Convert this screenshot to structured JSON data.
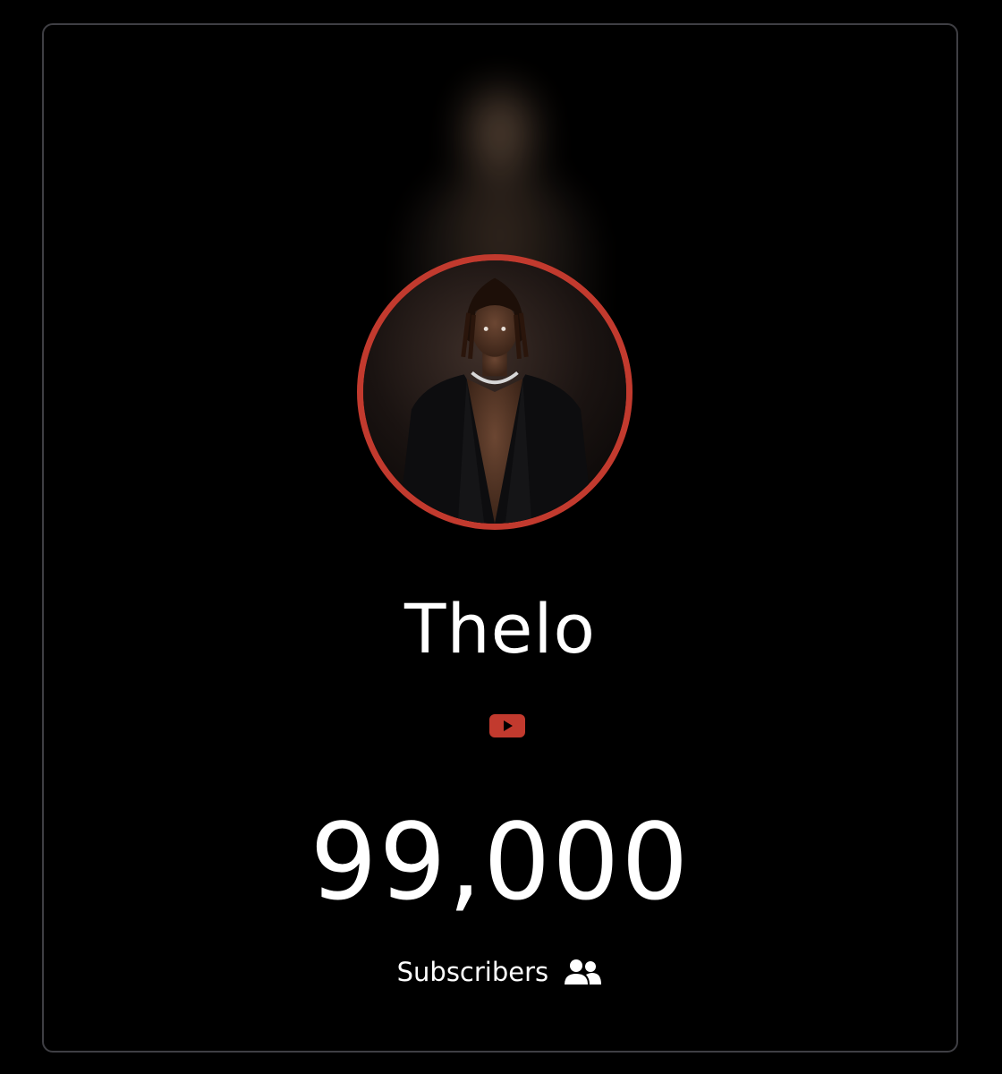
{
  "profile": {
    "name": "Thelo",
    "platform_icon": "youtube-icon",
    "subscriber_count": "99,000",
    "subscribers_label": "Subscribers",
    "subscribers_icon": "users-icon"
  },
  "colors": {
    "accent": "#c23a2e",
    "background": "#000000",
    "border": "#3f3f44",
    "text": "#ffffff"
  }
}
